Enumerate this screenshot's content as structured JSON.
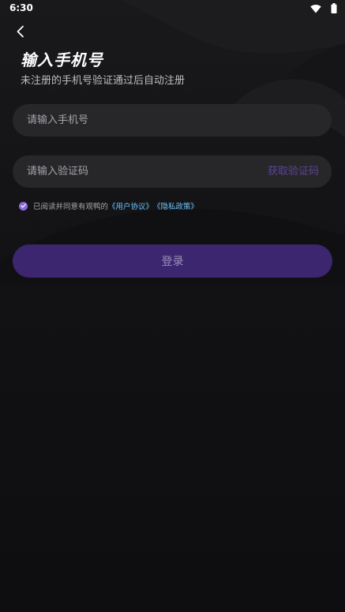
{
  "status_bar": {
    "time": "6:30",
    "icons": [
      "wifi-icon",
      "battery-icon"
    ]
  },
  "header": {
    "back_icon": "chevron-left-icon",
    "title": "输入手机号",
    "subtitle": "未注册的手机号验证通过后自动注册"
  },
  "form": {
    "phone_placeholder": "请输入手机号",
    "phone_value": "",
    "code_placeholder": "请输入验证码",
    "code_value": "",
    "get_code_label": "获取验证码"
  },
  "agreement": {
    "checked": true,
    "prefix": "已阅读并同意有观鸭的",
    "user_agreement": "《用户协议》",
    "privacy_policy": "《隐私政策》"
  },
  "login_button": {
    "label": "登录"
  },
  "colors": {
    "background": "#0e0e10",
    "field_background": "#27272a",
    "accent": "#8a6ad9",
    "button_background": "#3d2670",
    "link": "#6cc4ff",
    "get_code": "#5b4594"
  }
}
